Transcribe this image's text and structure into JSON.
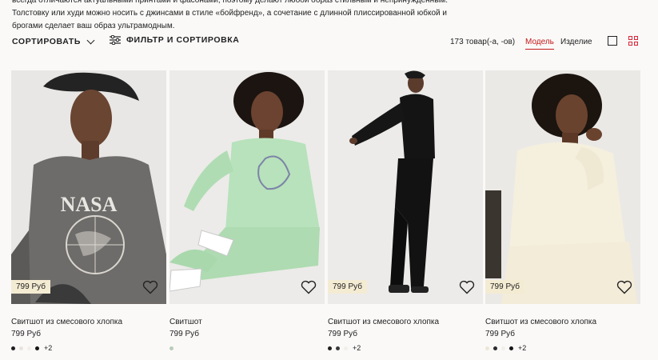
{
  "intro": {
    "line1": "всегда отличаются актуальными принтами и фасонами, поэтому делают любой образ стильным и непринужденным.",
    "line2": "Толстовку или худи можно носить с джинсами в стиле «бойфренд», а сочетание с длинной плиссированной юбкой и",
    "line3": "брогами сделает ваш образ ультрамодным."
  },
  "toolbar": {
    "sort_label": "СОРТИРОВАТЬ",
    "filter_label": "ФИЛЬТР И СОРТИРОВКА",
    "count": "173 товар(-а, -ов)",
    "tab_model": "Модель",
    "tab_product": "Изделие"
  },
  "colors": {
    "accent": "#c41a1a",
    "price_tag_bg": "#f4ebd3",
    "background": "#faf9f8"
  },
  "products": [
    {
      "title": "Свитшот из смесового хлопка",
      "price": "799 Руб",
      "tag_price": "799 Руб",
      "more": "+2",
      "swatches": [
        "#1f1f1f",
        "#e8e4dc",
        "#f1efe8",
        "#151515"
      ],
      "icon": "heart-icon"
    },
    {
      "title": "Свитшот",
      "price": "799 Руб",
      "tag_price": "",
      "more": "",
      "swatches": [
        "#b9cdb8"
      ],
      "icon": "heart-icon"
    },
    {
      "title": "Свитшот из смесового хлопка",
      "price": "799 Руб",
      "tag_price": "799 Руб",
      "more": "+2",
      "swatches": [
        "#1f1f1f",
        "#3a3a3a",
        "#f1efe8"
      ],
      "icon": "heart-icon"
    },
    {
      "title": "Свитшот из смесового хлопка",
      "price": "799 Руб",
      "tag_price": "799 Руб",
      "more": "+2",
      "swatches": [
        "#ece7d4",
        "#2b2b2b",
        "#f1efe8",
        "#161616"
      ],
      "icon": "heart-icon"
    }
  ]
}
